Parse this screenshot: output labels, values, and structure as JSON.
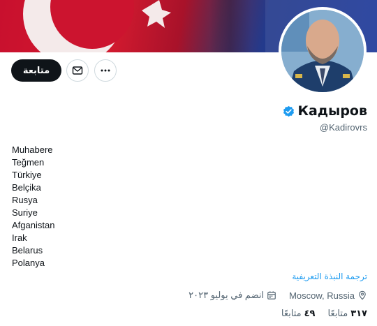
{
  "profile": {
    "display_name": "Кадыров",
    "handle": "@Kadirovrs",
    "verified": true
  },
  "actions": {
    "follow_label": "متابعة",
    "message_icon": "mail-icon",
    "more_icon": "more-icon"
  },
  "bio_lines": [
    "Muhabere",
    "Teğmen",
    "Türkiye",
    "Belçika",
    "Rusya",
    "Suriye",
    "Afganistan",
    "Irak",
    "Belarus",
    "Polanya"
  ],
  "translate_bio": "ترجمة النبذة التعريفية",
  "meta": {
    "location": "Moscow, Russia",
    "joined": "انضم في يوليو ٢٠٢٣"
  },
  "stats": {
    "followers_num": "٣١٧",
    "followers_label": "متابعًا",
    "following_num": "٤٩",
    "following_label": "متابعًا"
  },
  "colors": {
    "accent": "#1d9bf0",
    "verified": "#1d9bf0"
  }
}
